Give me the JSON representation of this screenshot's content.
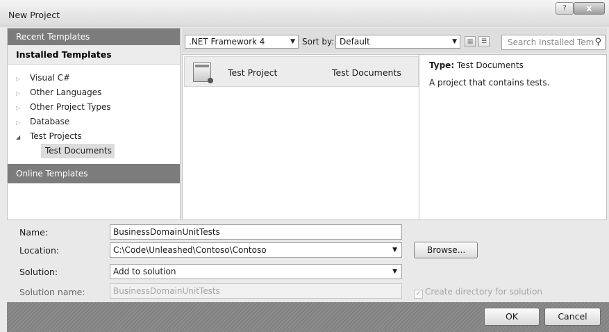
{
  "window": {
    "title": "New Project",
    "help_label": "?",
    "close_label": "x"
  },
  "sidebar": {
    "recent_label": "Recent Templates",
    "installed_label": "Installed Templates",
    "tree": [
      {
        "label": "Visual C#",
        "expanded": false
      },
      {
        "label": "Other Languages",
        "expanded": false
      },
      {
        "label": "Other Project Types",
        "expanded": false
      },
      {
        "label": "Database",
        "expanded": false
      },
      {
        "label": "Test Projects",
        "expanded": true
      }
    ],
    "selected_child": "Test Documents",
    "online_label": "Online Templates"
  },
  "toolbar": {
    "framework": ".NET Framework 4",
    "sort_label": "Sort by:",
    "sort_value": "Default",
    "search_placeholder": "Search Installed Tem",
    "view_icons": [
      "small-icons-view-icon",
      "medium-icons-view-icon"
    ]
  },
  "templates": [
    {
      "name": "Test Project",
      "category": "Test Documents",
      "icon": "test-project-icon"
    }
  ],
  "details": {
    "type_label": "Type:",
    "type_value": "Test Documents",
    "description": "A project that contains tests."
  },
  "form": {
    "name_label": "Name:",
    "name_value": "BusinessDomainUnitTests",
    "location_label": "Location:",
    "location_value": "C:\\Code\\Unleashed\\Contoso\\Contoso",
    "browse_label": "Browse...",
    "solution_label": "Solution:",
    "solution_value": "Add to solution",
    "solution_name_label": "Solution name:",
    "solution_name_value": "BusinessDomainUnitTests",
    "create_dir_label": "Create directory for solution",
    "create_dir_checked": true
  },
  "buttons": {
    "ok": "OK",
    "cancel": "Cancel"
  }
}
